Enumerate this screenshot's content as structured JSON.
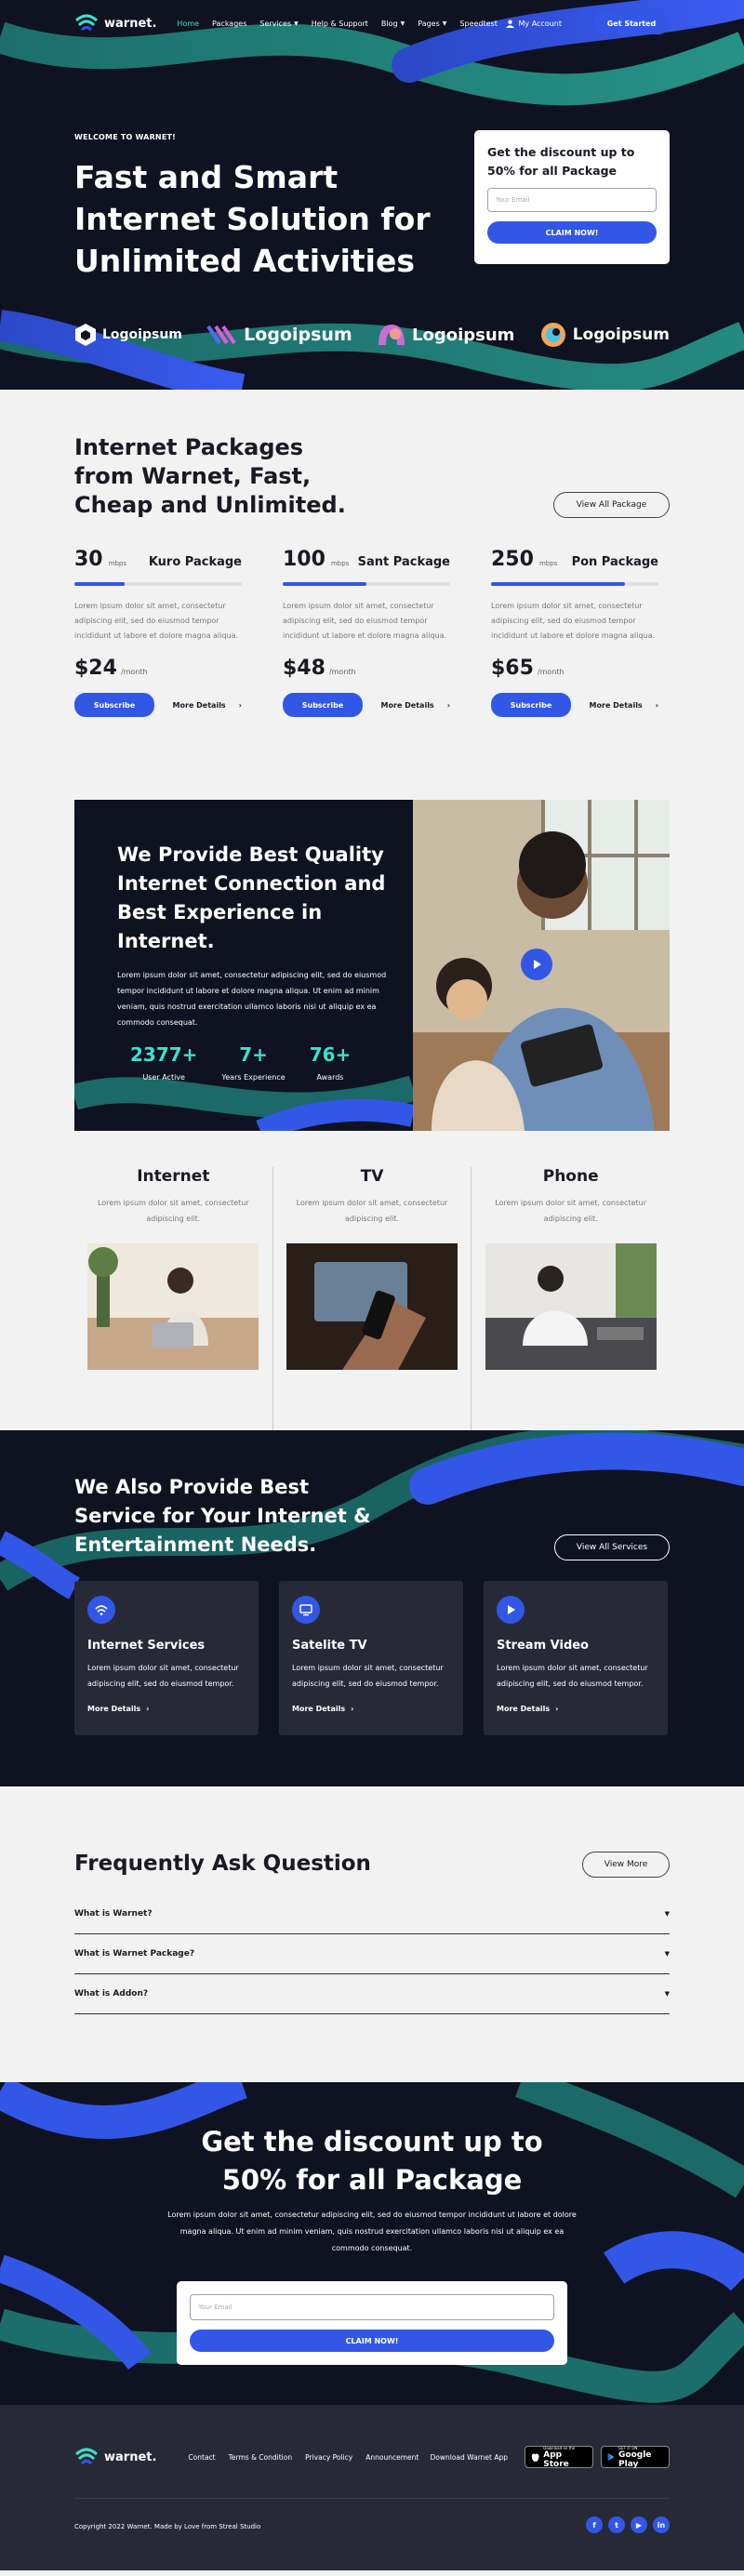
{
  "brand": {
    "name": "warnet.",
    "accent": "#3257e6",
    "teal": "#3de0d0",
    "dark": "#0f1220"
  },
  "nav": {
    "items": [
      "Home",
      "Packages",
      "Services",
      "Help & Support",
      "Blog",
      "Pages",
      "Speedtest"
    ],
    "account": "My Account",
    "cta": "Get Started"
  },
  "hero": {
    "eyebrow": "WELCOME TO WARNET!",
    "title": "Fast and Smart Internet Solution for Unlimited Activities",
    "card_title": "Get the discount up to 50% for all Package",
    "email_placeholder": "Your Email",
    "claim": "CLAIM NOW!",
    "logos": [
      "Logoipsum",
      "Logoipsum",
      "Logoipsum",
      "Logoipsum"
    ]
  },
  "packages": {
    "title": "Internet Packages from Warnet, Fast, Cheap and Unlimited.",
    "view_all": "View All Package",
    "items": [
      {
        "speed": "30",
        "unit": "mbps",
        "name": "Kuro Package",
        "fill": 0.3,
        "desc": "Lorem ipsum dolor sit amet, consectetur adipiscing elit, sed do eiusmod tempor incididunt ut labore et dolore magna aliqua.",
        "price": "$24",
        "per": "/month",
        "subscribe": "Subscribe",
        "details": "More Details"
      },
      {
        "speed": "100",
        "unit": "mbps",
        "name": "Sant Package",
        "fill": 0.5,
        "desc": "Lorem ipsum dolor sit amet, consectetur adipiscing elit, sed do eiusmod tempor incididunt ut labore et dolore magna aliqua.",
        "price": "$48",
        "per": "/month",
        "subscribe": "Subscribe",
        "details": "More Details"
      },
      {
        "speed": "250",
        "unit": "mbps",
        "name": "Pon Package",
        "fill": 0.8,
        "desc": "Lorem ipsum dolor sit amet, consectetur adipiscing elit, sed do eiusmod tempor incididunt ut labore et dolore magna aliqua.",
        "price": "$65",
        "per": "/month",
        "subscribe": "Subscribe",
        "details": "More Details"
      }
    ]
  },
  "provide": {
    "title": "We Provide Best Quality Internet Connection and Best Experience in Internet.",
    "desc": "Lorem ipsum dolor sit amet, consectetur adipiscing elit, sed do eiusmod tempor incididunt ut labore et dolore magna aliqua. Ut enim ad minim veniam, quis nostrud exercitation ullamco laboris nisi ut aliquip ex ea commodo consequat.",
    "stats": [
      {
        "value": "2377+",
        "label": "User Active"
      },
      {
        "value": "7+",
        "label": "Years Experience"
      },
      {
        "value": "76+",
        "label": "Awards"
      }
    ]
  },
  "columns": [
    {
      "title": "Internet",
      "desc": "Lorem ipsum dolor sit amet, consectetur adipiscing elit."
    },
    {
      "title": "TV",
      "desc": "Lorem ipsum dolor sit amet, consectetur adipiscing elit."
    },
    {
      "title": "Phone",
      "desc": "Lorem ipsum dolor sit amet, consectetur adipiscing elit."
    }
  ],
  "also": {
    "title": "We Also Provide Best Service for Your Internet & Entertainment Needs.",
    "view_all": "View All Services",
    "cards": [
      {
        "icon": "globe-icon",
        "title": "Internet Services",
        "desc": "Lorem ipsum dolor sit amet, consectetur adipiscing elit, sed do eiusmod tempor.",
        "more": "More Details"
      },
      {
        "icon": "monitor-icon",
        "title": "Satelite TV",
        "desc": "Lorem ipsum dolor sit amet, consectetur adipiscing elit, sed do eiusmod tempor.",
        "more": "More Details"
      },
      {
        "icon": "play-icon",
        "title": "Stream Video",
        "desc": "Lorem ipsum dolor sit amet, consectetur adipiscing elit, sed do eiusmod tempor.",
        "more": "More Details"
      }
    ]
  },
  "faq": {
    "title": "Frequently Ask Question",
    "view_more": "View More",
    "items": [
      "What is Warnet?",
      "What is Warnet Package?",
      "What is Addon?"
    ]
  },
  "cta": {
    "title": "Get the discount up to 50% for all Package",
    "desc": "Lorem ipsum dolor sit amet, consectetur adipiscing elit, sed do eiusmod tempor incididunt ut labore et dolore magna aliqua. Ut enim ad minim veniam, quis nostrud exercitation ullamco laboris nisi ut aliquip ex ea commodo consequat.",
    "email_placeholder": "Your Email",
    "claim": "CLAIM NOW!"
  },
  "footer": {
    "links": [
      "Contact",
      "Terms & Condition",
      "Privacy Policy",
      "Announcement"
    ],
    "download": "Download Warnet App",
    "appstore_small": "Download on the",
    "appstore": "App Store",
    "gplay_small": "GET IT ON",
    "gplay": "Google Play",
    "copyright": "Copyright 2022 Warnet. Made by Love from Streal Studio",
    "socials": [
      "f",
      "t",
      "▶",
      "in"
    ]
  }
}
